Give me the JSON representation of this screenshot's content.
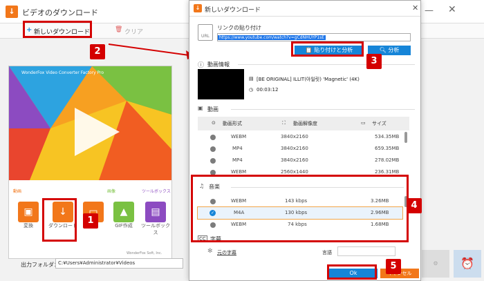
{
  "main_window": {
    "title": "ビデオのダウンロード",
    "toolbar": {
      "new_download": "新しいダウンロード",
      "clear": "クリア"
    },
    "promo": {
      "app_name": "WonderFox Video Converter Factory Pro",
      "sections": [
        "動画",
        "画像",
        "ツールボックス"
      ],
      "tools": [
        "変換",
        "ダウンロード",
        "録画",
        "GIF作成",
        "ツールボックス"
      ],
      "footer_brand": "WonderFox Soft, Inc."
    },
    "output_folder_label": "出力フォルダ：",
    "output_folder_path": "C:¥Users¥Administrator¥Videos"
  },
  "dialog": {
    "title": "新しいダウンロード",
    "paste_link_label": "リンクの貼り付け",
    "url_value": "https://www.youtube.com/watch?v=gCdNHUYP1sE",
    "paste_analyze": "貼り付けと分析",
    "analyze": "分析",
    "video_info_label": "動画情報",
    "video_title": "[BE ORIGINAL] ILLIT(아일릿) 'Magnetic' (4K)",
    "duration": "00:03:12",
    "video_section_label": "動画",
    "video_columns": [
      "動画形式",
      "動画解像度",
      "サイズ"
    ],
    "video_rows": [
      {
        "format": "WEBM",
        "resolution": "3840x2160",
        "size": "534.35MB"
      },
      {
        "format": "MP4",
        "resolution": "3840x2160",
        "size": "659.35MB"
      },
      {
        "format": "MP4",
        "resolution": "3840x2160",
        "size": "278.02MB"
      },
      {
        "format": "WEBM",
        "resolution": "2560x1440",
        "size": "236.31MB"
      }
    ],
    "audio_section_label": "音楽",
    "audio_rows": [
      {
        "format": "WEBM",
        "bitrate": "143 kbps",
        "size": "3.26MB"
      },
      {
        "format": "M4A",
        "bitrate": "130 kbps",
        "size": "2.96MB"
      },
      {
        "format": "WEBM",
        "bitrate": "74 kbps",
        "size": "1.68MB"
      }
    ],
    "subtitle_section_label": "字幕",
    "original_subtitle": "元の字幕",
    "language_label": "言語",
    "ok": "Ok",
    "cancel": "キャンセル"
  },
  "badges": [
    "1",
    "2",
    "3",
    "4",
    "5"
  ],
  "colors": {
    "accent_orange": "#f2771a",
    "accent_blue": "#1685d8",
    "annotation_red": "#d40000"
  }
}
